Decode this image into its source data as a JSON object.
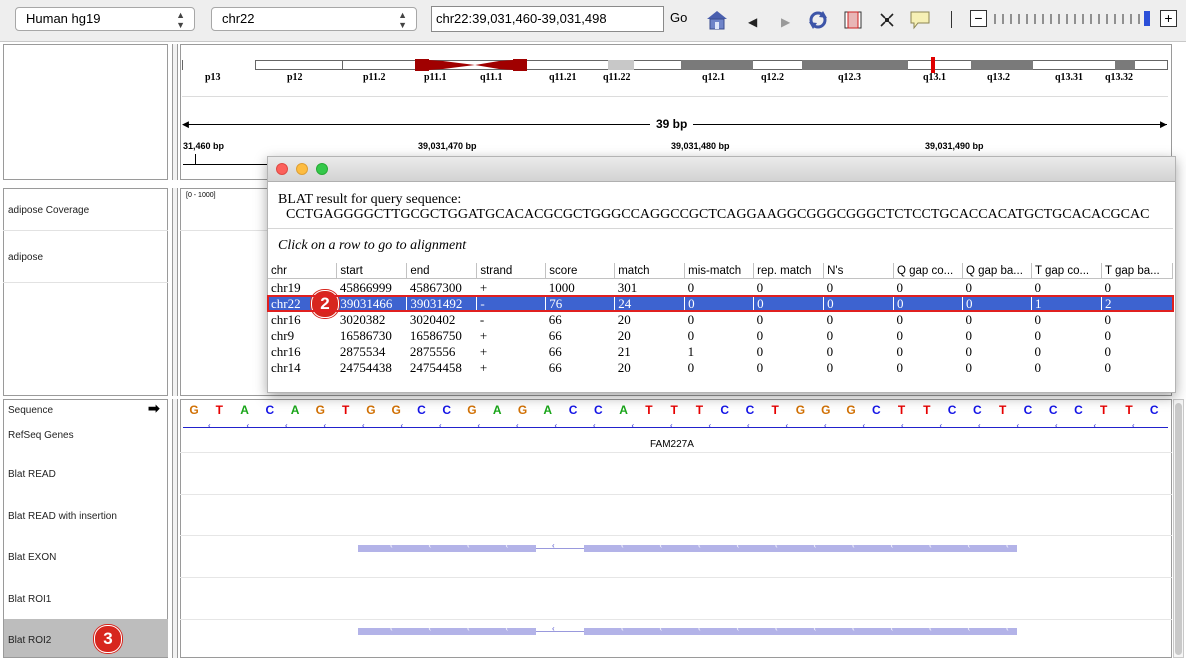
{
  "toolbar": {
    "genome": "Human hg19",
    "chromosome": "chr22",
    "locus": "chr22:39,031,460-39,031,498",
    "go_label": "Go"
  },
  "ideogram": {
    "bands": [
      "p13",
      "p12",
      "p11.2",
      "p11.1",
      "q11.1",
      "q11.21",
      "q11.22",
      "q12.1",
      "q12.2",
      "q12.3",
      "q13.1",
      "q13.2",
      "q13.31",
      "q13.32"
    ]
  },
  "ruler": {
    "span": "39 bp",
    "ticks": [
      "31,460 bp",
      "39,031,470 bp",
      "39,031,480 bp",
      "39,031,490 bp"
    ]
  },
  "data_panel": {
    "tracks": [
      "adipose Coverage",
      "adipose"
    ],
    "coverage_range": "[0 - 1000]"
  },
  "feature_panel": {
    "tracks": [
      "Sequence",
      "RefSeq Genes",
      "Blat READ",
      "Blat READ with insertion",
      "Blat EXON",
      "Blat ROI1",
      "Blat ROI2"
    ],
    "sequence": [
      "G",
      "T",
      "A",
      "C",
      "A",
      "G",
      "T",
      "G",
      "G",
      "C",
      "C",
      "G",
      "A",
      "G",
      "A",
      "C",
      "C",
      "A",
      "T",
      "T",
      "T",
      "C",
      "C",
      "T",
      "G",
      "G",
      "G",
      "C",
      "T",
      "T",
      "C",
      "C",
      "T",
      "C",
      "C",
      "C",
      "T",
      "T",
      "C"
    ],
    "gene_label": "FAM227A",
    "base_colors": {
      "A": "#19a519",
      "C": "#1414e6",
      "G": "#d17105",
      "T": "#e60000"
    }
  },
  "dialog": {
    "header": "BLAT result for query sequence:",
    "query": "CCTGAGGGGCTTGCGCTGGATGCACACGCGCTGGGCCAGGCCGCTCAGGAAGGCGGGCGGGCTCTCCTGCACCACATGCTGCACACGCAC",
    "hint": "Click on a row to go to alignment",
    "columns": [
      "chr",
      "start",
      "end",
      "strand",
      "score",
      "match",
      "mis-match",
      "rep. match",
      "N's",
      "Q gap co...",
      "Q gap ba...",
      "T gap co...",
      "T gap ba..."
    ],
    "rows": [
      [
        "chr19",
        "45866999",
        "45867300",
        "+",
        "1000",
        "301",
        "0",
        "0",
        "0",
        "0",
        "0",
        "0",
        "0"
      ],
      [
        "chr22",
        "39031466",
        "39031492",
        "-",
        "76",
        "24",
        "0",
        "0",
        "0",
        "0",
        "0",
        "1",
        "2"
      ],
      [
        "chr16",
        "3020382",
        "3020402",
        "-",
        "66",
        "20",
        "0",
        "0",
        "0",
        "0",
        "0",
        "0",
        "0"
      ],
      [
        "chr9",
        "16586730",
        "16586750",
        "+",
        "66",
        "20",
        "0",
        "0",
        "0",
        "0",
        "0",
        "0",
        "0"
      ],
      [
        "chr16",
        "2875534",
        "2875556",
        "+",
        "66",
        "21",
        "1",
        "0",
        "0",
        "0",
        "0",
        "0",
        "0"
      ],
      [
        "chr14",
        "24754438",
        "24754458",
        "+",
        "66",
        "20",
        "0",
        "0",
        "0",
        "0",
        "0",
        "0",
        "0"
      ]
    ],
    "selected_row": 1
  },
  "callouts": {
    "badge_row": "2",
    "badge_track": "3"
  }
}
